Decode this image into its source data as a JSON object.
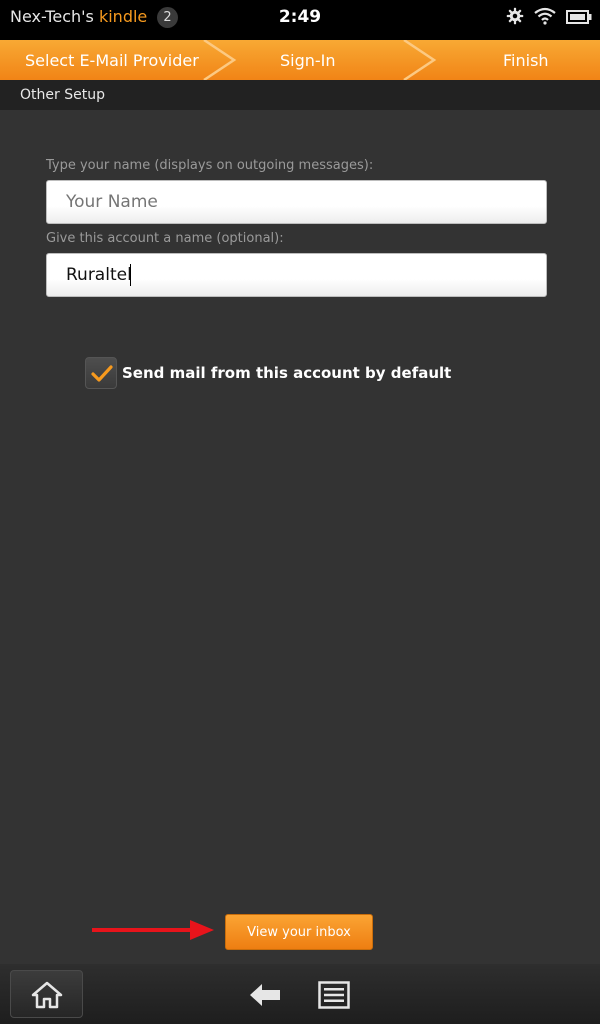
{
  "status_bar": {
    "owner": "Nex-Tech's",
    "brand": "kindle",
    "notifications": "2",
    "time": "2:49",
    "icons": [
      "gear-icon",
      "wifi-icon",
      "battery-icon"
    ]
  },
  "wizard": {
    "steps": [
      {
        "label": "Select E-Mail Provider"
      },
      {
        "label": "Sign-In"
      },
      {
        "label": "Finish"
      }
    ]
  },
  "section": {
    "title": "Other Setup"
  },
  "form": {
    "name_label": "Type your name (displays on outgoing messages):",
    "name_placeholder": "Your Name",
    "name_value": "",
    "account_label": "Give this account a name (optional):",
    "account_value": "Ruraltel",
    "default_checkbox_label": "Send mail from this account by default",
    "default_checked": true
  },
  "actions": {
    "view_inbox": "View your inbox"
  },
  "nav": {
    "icons": [
      "home-icon",
      "back-arrow-icon",
      "menu-icon"
    ]
  },
  "colors": {
    "accent": "#f18416",
    "annotation_arrow": "#e8141b",
    "background": "#333333"
  }
}
